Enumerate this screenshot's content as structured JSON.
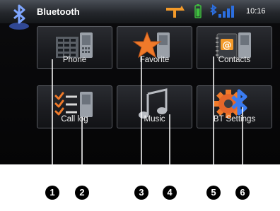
{
  "header": {
    "title": "Bluetooth",
    "clock": "10:16",
    "icons": [
      "bluetooth-logo-icon",
      "road-icon",
      "battery-icon",
      "bluetooth-signal-icon"
    ]
  },
  "tiles": [
    {
      "label": "Phone",
      "icon": "phone-icon"
    },
    {
      "label": "Favorite",
      "icon": "star-icon"
    },
    {
      "label": "Contacts",
      "icon": "contacts-icon"
    },
    {
      "label": "Call log",
      "icon": "call-log-icon"
    },
    {
      "label": "Music",
      "icon": "music-note-icon"
    },
    {
      "label": "BT Settings",
      "icon": "bt-settings-gear-icon"
    }
  ],
  "callouts": [
    "1",
    "2",
    "3",
    "4",
    "5",
    "6"
  ],
  "colors": {
    "accent_orange": "#f39a2a",
    "battery_green": "#3fbf3f",
    "bluetooth_blue": "#2c6fe0"
  }
}
